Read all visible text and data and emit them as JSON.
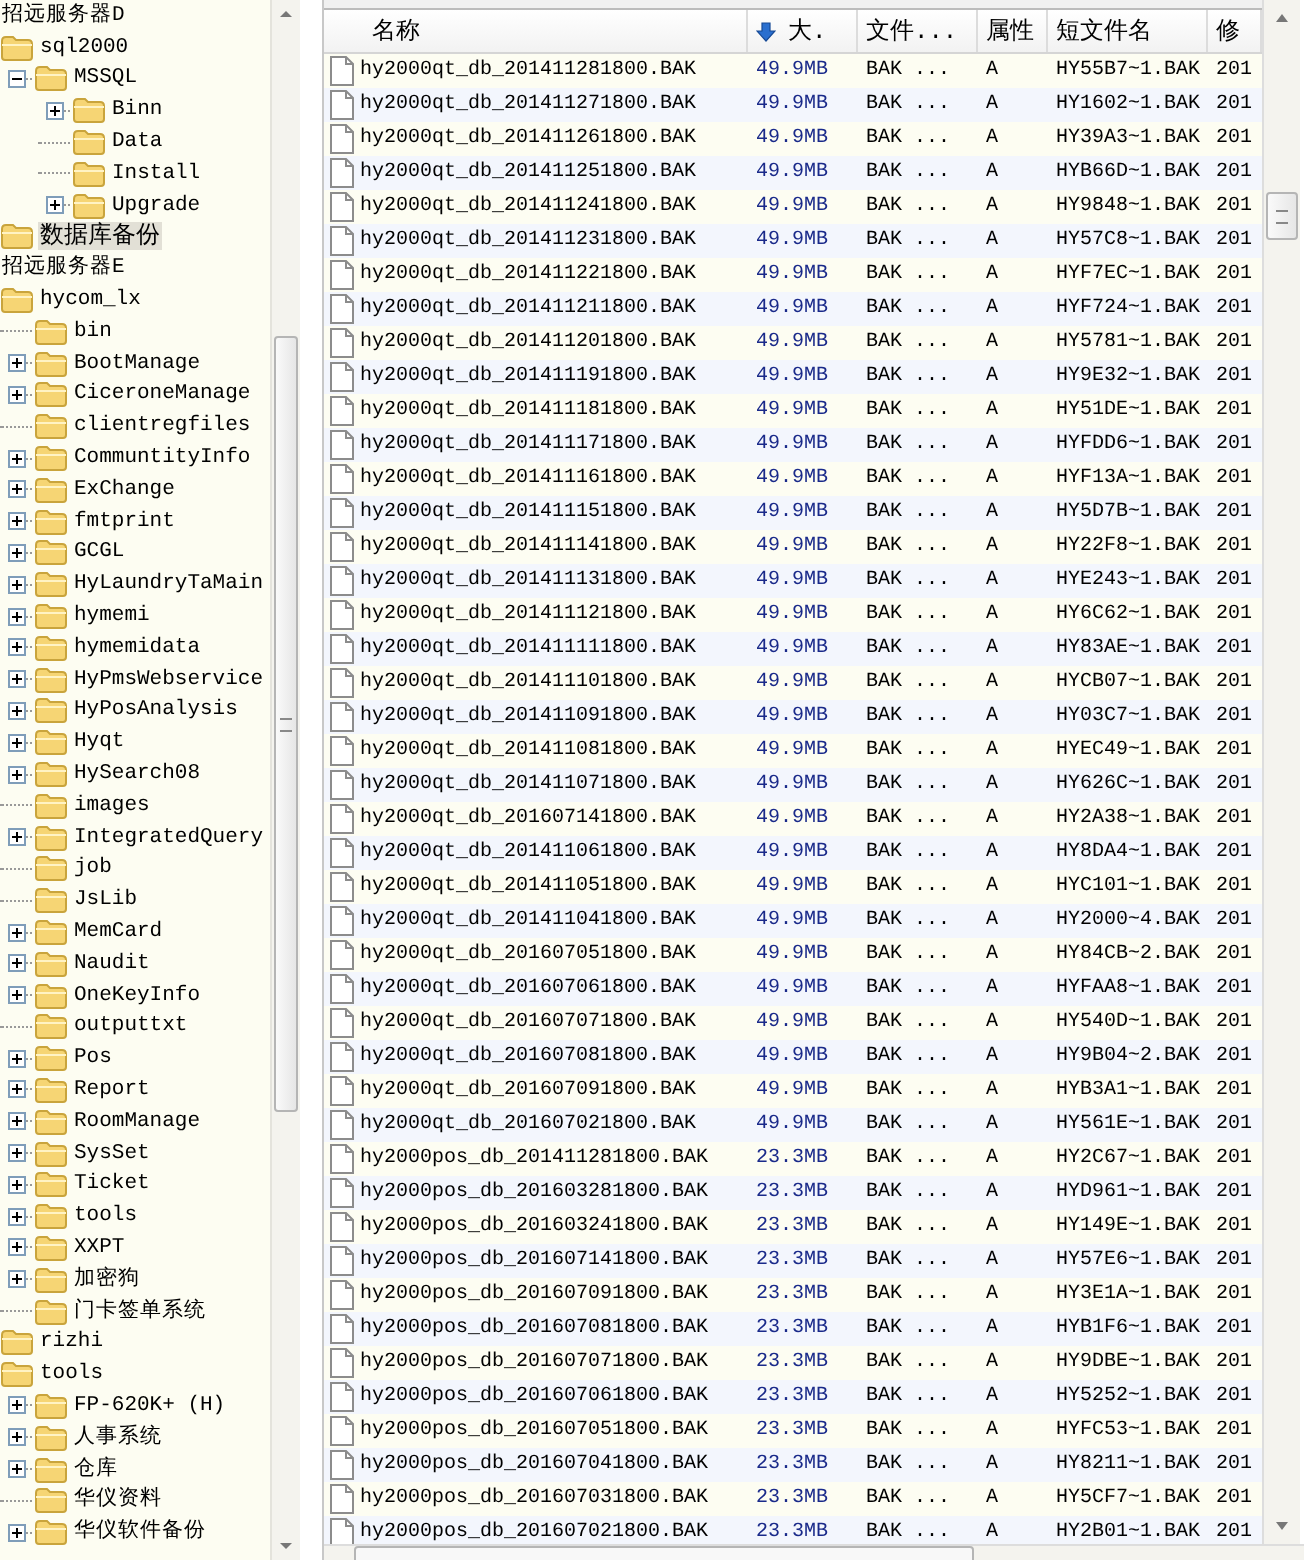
{
  "tree": [
    {
      "label": "招远服务器D",
      "selected": false,
      "children": [
        {
          "label": "sql2000",
          "selected": false,
          "children": [
            {
              "label": "MSSQL",
              "expanded": true,
              "selected": false,
              "children": [
                {
                  "label": "Binn",
                  "expanded": false,
                  "selected": false
                },
                {
                  "label": "Data",
                  "selected": false
                },
                {
                  "label": "Install",
                  "selected": false
                },
                {
                  "label": "Upgrade",
                  "expanded": false,
                  "selected": false
                }
              ]
            }
          ]
        },
        {
          "label": "数据库备份",
          "selected": true
        }
      ]
    },
    {
      "label": "招远服务器E",
      "selected": false,
      "children": [
        {
          "label": "hycom_lx",
          "selected": false,
          "children": [
            {
              "label": "bin",
              "selected": false
            },
            {
              "label": "BootManage",
              "expanded": false,
              "selected": false
            },
            {
              "label": "CiceroneManage",
              "expanded": false,
              "selected": false
            },
            {
              "label": "clientregfiles",
              "selected": false
            },
            {
              "label": "CommuntityInfo",
              "expanded": false,
              "selected": false
            },
            {
              "label": "ExChange",
              "expanded": false,
              "selected": false
            },
            {
              "label": "fmtprint",
              "expanded": false,
              "selected": false
            },
            {
              "label": "GCGL",
              "expanded": false,
              "selected": false
            },
            {
              "label": "HyLaundryTaMain",
              "expanded": false,
              "selected": false
            },
            {
              "label": "hymemi",
              "expanded": false,
              "selected": false
            },
            {
              "label": "hymemidata",
              "expanded": false,
              "selected": false
            },
            {
              "label": "HyPmsWebservice",
              "expanded": false,
              "selected": false
            },
            {
              "label": "HyPosAnalysis",
              "expanded": false,
              "selected": false
            },
            {
              "label": "Hyqt",
              "expanded": false,
              "selected": false
            },
            {
              "label": "HySearch08",
              "expanded": false,
              "selected": false
            },
            {
              "label": "images",
              "selected": false
            },
            {
              "label": "IntegratedQuery",
              "expanded": false,
              "selected": false
            },
            {
              "label": "job",
              "selected": false
            },
            {
              "label": "JsLib",
              "selected": false
            },
            {
              "label": "MemCard",
              "expanded": false,
              "selected": false
            },
            {
              "label": "Naudit",
              "expanded": false,
              "selected": false
            },
            {
              "label": "OneKeyInfo",
              "expanded": false,
              "selected": false
            },
            {
              "label": "outputtxt",
              "selected": false
            },
            {
              "label": "Pos",
              "expanded": false,
              "selected": false
            },
            {
              "label": "Report",
              "expanded": false,
              "selected": false
            },
            {
              "label": "RoomManage",
              "expanded": false,
              "selected": false
            },
            {
              "label": "SysSet",
              "expanded": false,
              "selected": false
            },
            {
              "label": "Ticket",
              "expanded": false,
              "selected": false
            },
            {
              "label": "tools",
              "expanded": false,
              "selected": false
            },
            {
              "label": "XXPT",
              "expanded": false,
              "selected": false
            },
            {
              "label": "加密狗",
              "expanded": false,
              "selected": false
            },
            {
              "label": "门卡签单系统",
              "selected": false
            }
          ]
        },
        {
          "label": "rizhi",
          "selected": false
        },
        {
          "label": "tools",
          "selected": false,
          "children": [
            {
              "label": "FP-620K+ (H)",
              "expanded": false,
              "selected": false
            },
            {
              "label": "人事系统",
              "expanded": false,
              "selected": false
            },
            {
              "label": "仓库",
              "expanded": false,
              "selected": false
            },
            {
              "label": "华仪资料",
              "selected": false
            },
            {
              "label": "华仪软件备份",
              "expanded": false,
              "selected": false
            }
          ]
        }
      ]
    }
  ],
  "list": {
    "columns": [
      {
        "label": "名称"
      },
      {
        "label": "大.",
        "sorted": true
      },
      {
        "label": "文件..."
      },
      {
        "label": "属性"
      },
      {
        "label": "短文件名"
      },
      {
        "label": "修"
      }
    ],
    "rows": [
      {
        "name": "hy2000qt_db_201411281800.BAK",
        "size": "49.9MB",
        "type": "BAK ...",
        "attributes": "A",
        "short_name": "HY55B7~1.BAK",
        "column_6": "201"
      },
      {
        "name": "hy2000qt_db_201411271800.BAK",
        "size": "49.9MB",
        "type": "BAK ...",
        "attributes": "A",
        "short_name": "HY1602~1.BAK",
        "column_6": "201"
      },
      {
        "name": "hy2000qt_db_201411261800.BAK",
        "size": "49.9MB",
        "type": "BAK ...",
        "attributes": "A",
        "short_name": "HY39A3~1.BAK",
        "column_6": "201"
      },
      {
        "name": "hy2000qt_db_201411251800.BAK",
        "size": "49.9MB",
        "type": "BAK ...",
        "attributes": "A",
        "short_name": "HYB66D~1.BAK",
        "column_6": "201"
      },
      {
        "name": "hy2000qt_db_201411241800.BAK",
        "size": "49.9MB",
        "type": "BAK ...",
        "attributes": "A",
        "short_name": "HY9848~1.BAK",
        "column_6": "201"
      },
      {
        "name": "hy2000qt_db_201411231800.BAK",
        "size": "49.9MB",
        "type": "BAK ...",
        "attributes": "A",
        "short_name": "HY57C8~1.BAK",
        "column_6": "201"
      },
      {
        "name": "hy2000qt_db_201411221800.BAK",
        "size": "49.9MB",
        "type": "BAK ...",
        "attributes": "A",
        "short_name": "HYF7EC~1.BAK",
        "column_6": "201"
      },
      {
        "name": "hy2000qt_db_201411211800.BAK",
        "size": "49.9MB",
        "type": "BAK ...",
        "attributes": "A",
        "short_name": "HYF724~1.BAK",
        "column_6": "201"
      },
      {
        "name": "hy2000qt_db_201411201800.BAK",
        "size": "49.9MB",
        "type": "BAK ...",
        "attributes": "A",
        "short_name": "HY5781~1.BAK",
        "column_6": "201"
      },
      {
        "name": "hy2000qt_db_201411191800.BAK",
        "size": "49.9MB",
        "type": "BAK ...",
        "attributes": "A",
        "short_name": "HY9E32~1.BAK",
        "column_6": "201"
      },
      {
        "name": "hy2000qt_db_201411181800.BAK",
        "size": "49.9MB",
        "type": "BAK ...",
        "attributes": "A",
        "short_name": "HY51DE~1.BAK",
        "column_6": "201"
      },
      {
        "name": "hy2000qt_db_201411171800.BAK",
        "size": "49.9MB",
        "type": "BAK ...",
        "attributes": "A",
        "short_name": "HYFDD6~1.BAK",
        "column_6": "201"
      },
      {
        "name": "hy2000qt_db_201411161800.BAK",
        "size": "49.9MB",
        "type": "BAK ...",
        "attributes": "A",
        "short_name": "HYF13A~1.BAK",
        "column_6": "201"
      },
      {
        "name": "hy2000qt_db_201411151800.BAK",
        "size": "49.9MB",
        "type": "BAK ...",
        "attributes": "A",
        "short_name": "HY5D7B~1.BAK",
        "column_6": "201"
      },
      {
        "name": "hy2000qt_db_201411141800.BAK",
        "size": "49.9MB",
        "type": "BAK ...",
        "attributes": "A",
        "short_name": "HY22F8~1.BAK",
        "column_6": "201"
      },
      {
        "name": "hy2000qt_db_201411131800.BAK",
        "size": "49.9MB",
        "type": "BAK ...",
        "attributes": "A",
        "short_name": "HYE243~1.BAK",
        "column_6": "201"
      },
      {
        "name": "hy2000qt_db_201411121800.BAK",
        "size": "49.9MB",
        "type": "BAK ...",
        "attributes": "A",
        "short_name": "HY6C62~1.BAK",
        "column_6": "201"
      },
      {
        "name": "hy2000qt_db_201411111800.BAK",
        "size": "49.9MB",
        "type": "BAK ...",
        "attributes": "A",
        "short_name": "HY83AE~1.BAK",
        "column_6": "201"
      },
      {
        "name": "hy2000qt_db_201411101800.BAK",
        "size": "49.9MB",
        "type": "BAK ...",
        "attributes": "A",
        "short_name": "HYCB07~1.BAK",
        "column_6": "201"
      },
      {
        "name": "hy2000qt_db_201411091800.BAK",
        "size": "49.9MB",
        "type": "BAK ...",
        "attributes": "A",
        "short_name": "HY03C7~1.BAK",
        "column_6": "201"
      },
      {
        "name": "hy2000qt_db_201411081800.BAK",
        "size": "49.9MB",
        "type": "BAK ...",
        "attributes": "A",
        "short_name": "HYEC49~1.BAK",
        "column_6": "201"
      },
      {
        "name": "hy2000qt_db_201411071800.BAK",
        "size": "49.9MB",
        "type": "BAK ...",
        "attributes": "A",
        "short_name": "HY626C~1.BAK",
        "column_6": "201"
      },
      {
        "name": "hy2000qt_db_201607141800.BAK",
        "size": "49.9MB",
        "type": "BAK ...",
        "attributes": "A",
        "short_name": "HY2A38~1.BAK",
        "column_6": "201"
      },
      {
        "name": "hy2000qt_db_201411061800.BAK",
        "size": "49.9MB",
        "type": "BAK ...",
        "attributes": "A",
        "short_name": "HY8DA4~1.BAK",
        "column_6": "201"
      },
      {
        "name": "hy2000qt_db_201411051800.BAK",
        "size": "49.9MB",
        "type": "BAK ...",
        "attributes": "A",
        "short_name": "HYC101~1.BAK",
        "column_6": "201"
      },
      {
        "name": "hy2000qt_db_201411041800.BAK",
        "size": "49.9MB",
        "type": "BAK ...",
        "attributes": "A",
        "short_name": "HY2000~4.BAK",
        "column_6": "201"
      },
      {
        "name": "hy2000qt_db_201607051800.BAK",
        "size": "49.9MB",
        "type": "BAK ...",
        "attributes": "A",
        "short_name": "HY84CB~2.BAK",
        "column_6": "201"
      },
      {
        "name": "hy2000qt_db_201607061800.BAK",
        "size": "49.9MB",
        "type": "BAK ...",
        "attributes": "A",
        "short_name": "HYFAA8~1.BAK",
        "column_6": "201"
      },
      {
        "name": "hy2000qt_db_201607071800.BAK",
        "size": "49.9MB",
        "type": "BAK ...",
        "attributes": "A",
        "short_name": "HY540D~1.BAK",
        "column_6": "201"
      },
      {
        "name": "hy2000qt_db_201607081800.BAK",
        "size": "49.9MB",
        "type": "BAK ...",
        "attributes": "A",
        "short_name": "HY9B04~2.BAK",
        "column_6": "201"
      },
      {
        "name": "hy2000qt_db_201607091800.BAK",
        "size": "49.9MB",
        "type": "BAK ...",
        "attributes": "A",
        "short_name": "HYB3A1~1.BAK",
        "column_6": "201"
      },
      {
        "name": "hy2000qt_db_201607021800.BAK",
        "size": "49.9MB",
        "type": "BAK ...",
        "attributes": "A",
        "short_name": "HY561E~1.BAK",
        "column_6": "201"
      },
      {
        "name": "hy2000pos_db_201411281800.BAK",
        "size": "23.3MB",
        "type": "BAK ...",
        "attributes": "A",
        "short_name": "HY2C67~1.BAK",
        "column_6": "201"
      },
      {
        "name": "hy2000pos_db_201603281800.BAK",
        "size": "23.3MB",
        "type": "BAK ...",
        "attributes": "A",
        "short_name": "HYD961~1.BAK",
        "column_6": "201"
      },
      {
        "name": "hy2000pos_db_201603241800.BAK",
        "size": "23.3MB",
        "type": "BAK ...",
        "attributes": "A",
        "short_name": "HY149E~1.BAK",
        "column_6": "201"
      },
      {
        "name": "hy2000pos_db_201607141800.BAK",
        "size": "23.3MB",
        "type": "BAK ...",
        "attributes": "A",
        "short_name": "HY57E6~1.BAK",
        "column_6": "201"
      },
      {
        "name": "hy2000pos_db_201607091800.BAK",
        "size": "23.3MB",
        "type": "BAK ...",
        "attributes": "A",
        "short_name": "HY3E1A~1.BAK",
        "column_6": "201"
      },
      {
        "name": "hy2000pos_db_201607081800.BAK",
        "size": "23.3MB",
        "type": "BAK ...",
        "attributes": "A",
        "short_name": "HYB1F6~1.BAK",
        "column_6": "201"
      },
      {
        "name": "hy2000pos_db_201607071800.BAK",
        "size": "23.3MB",
        "type": "BAK ...",
        "attributes": "A",
        "short_name": "HY9DBE~1.BAK",
        "column_6": "201"
      },
      {
        "name": "hy2000pos_db_201607061800.BAK",
        "size": "23.3MB",
        "type": "BAK ...",
        "attributes": "A",
        "short_name": "HY5252~1.BAK",
        "column_6": "201"
      },
      {
        "name": "hy2000pos_db_201607051800.BAK",
        "size": "23.3MB",
        "type": "BAK ...",
        "attributes": "A",
        "short_name": "HYFC53~1.BAK",
        "column_6": "201"
      },
      {
        "name": "hy2000pos_db_201607041800.BAK",
        "size": "23.3MB",
        "type": "BAK ...",
        "attributes": "A",
        "short_name": "HY8211~1.BAK",
        "column_6": "201"
      },
      {
        "name": "hy2000pos_db_201607031800.BAK",
        "size": "23.3MB",
        "type": "BAK ...",
        "attributes": "A",
        "short_name": "HY5CF7~1.BAK",
        "column_6": "201"
      },
      {
        "name": "hy2000pos_db_201607021800.BAK",
        "size": "23.3MB",
        "type": "BAK ...",
        "attributes": "A",
        "short_name": "HY2B01~1.BAK",
        "column_6": "201"
      }
    ]
  }
}
